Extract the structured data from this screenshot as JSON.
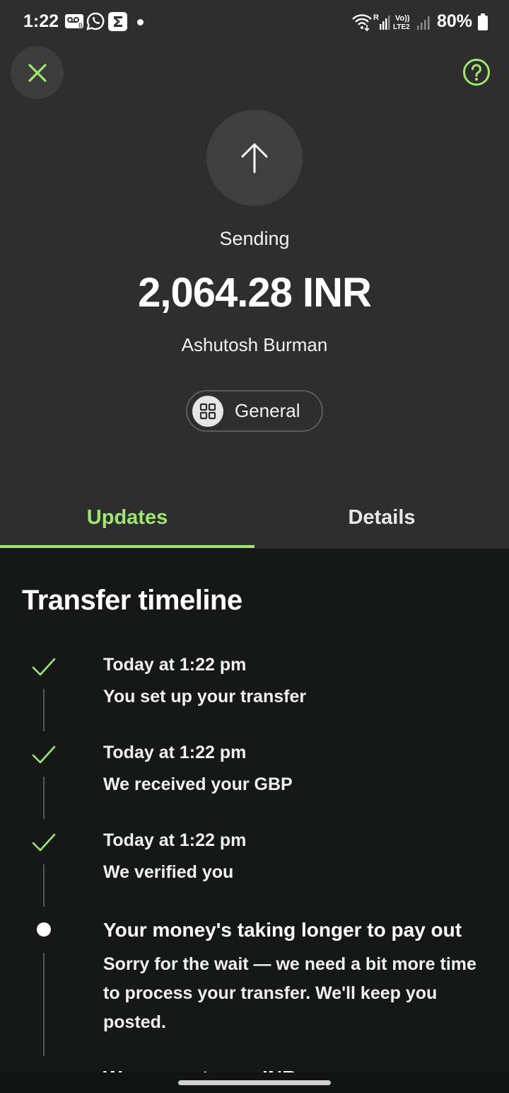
{
  "status_bar": {
    "time": "1:22",
    "battery": "80%",
    "icons": [
      "voicemail-icon",
      "whatsapp-icon",
      "sigma-icon",
      "wifi-icon",
      "signal-icon",
      "volte-icon",
      "signal-icon",
      "battery-icon"
    ]
  },
  "header": {
    "close_icon": "close-icon",
    "help_icon": "help-icon",
    "direction_icon": "arrow-up-icon"
  },
  "transfer": {
    "status": "Sending",
    "amount": "2,064.28 INR",
    "recipient": "Ashutosh Burman",
    "category": "General",
    "category_icon": "grid-icon"
  },
  "tabs": [
    {
      "label": "Updates",
      "active": true
    },
    {
      "label": "Details",
      "active": false
    }
  ],
  "timeline": {
    "title": "Transfer timeline",
    "items": [
      {
        "time": "Today at 1:22 pm",
        "text": "You set up your transfer",
        "state": "done"
      },
      {
        "time": "Today at 1:22 pm",
        "text": "We received your GBP",
        "state": "done"
      },
      {
        "time": "Today at 1:22 pm",
        "text": "We verified you",
        "state": "done"
      },
      {
        "heading": "Your money's taking longer to pay out",
        "text": "Sorry for the wait — we need a bit more time to process your transfer. We'll keep you posted.",
        "state": "current"
      }
    ],
    "next_partial": "We pay out your INR"
  },
  "colors": {
    "accent": "#9fe870",
    "top_background": "#2d2e2d",
    "bottom_background": "#161817"
  }
}
